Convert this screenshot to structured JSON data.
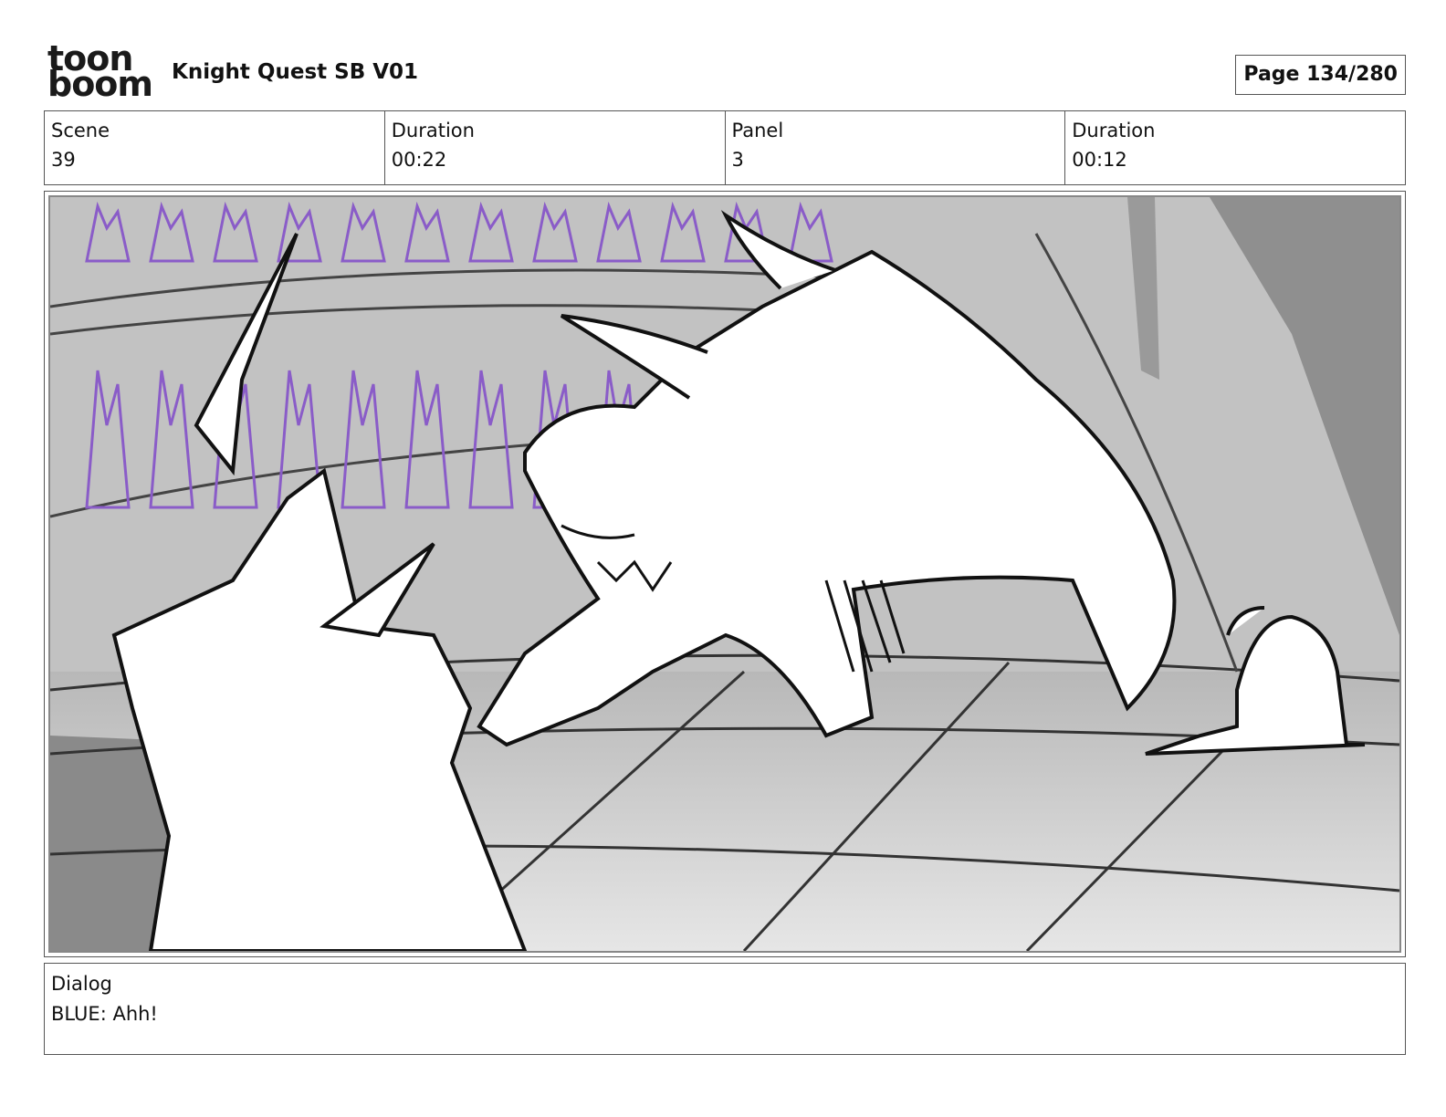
{
  "header": {
    "logo": {
      "line1": "toon",
      "line2": "boom",
      "name": "toon-boom-logo"
    },
    "doc_title": "Knight Quest SB V01",
    "page_label": "Page 134/280"
  },
  "info": {
    "scene_label": "Scene",
    "scene_value": "39",
    "scene_duration_label": "Duration",
    "scene_duration_value": "00:22",
    "panel_label": "Panel",
    "panel_value": "3",
    "panel_duration_label": "Duration",
    "panel_duration_value": "00:12"
  },
  "panel": {
    "image": "storyboard-sketch",
    "crystal_color": "#8a5cc8",
    "background_color": "#bdbdbd"
  },
  "dialog": {
    "label": "Dialog",
    "text": "BLUE: Ahh!"
  }
}
